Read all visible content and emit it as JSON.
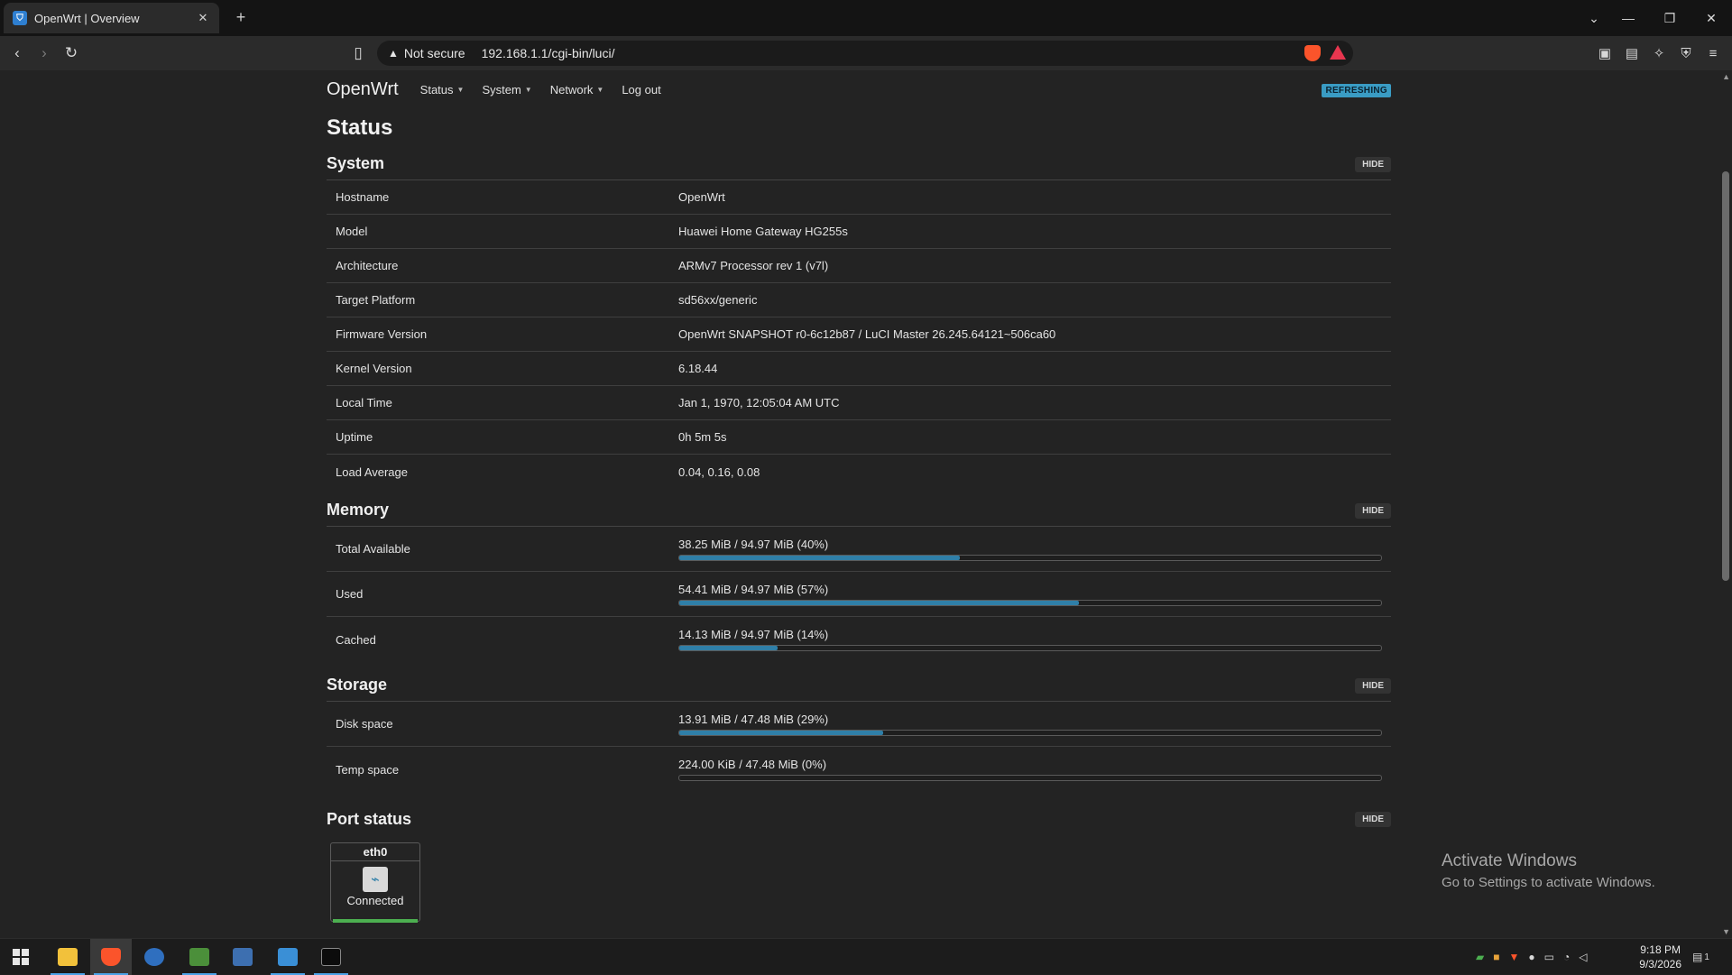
{
  "browser": {
    "tab_title": "OpenWrt | Overview",
    "new_tab": "+",
    "security_label": "Not secure",
    "url": "192.168.1.1/cgi-bin/luci/"
  },
  "header": {
    "brand": "OpenWrt",
    "menu": [
      "Status",
      "System",
      "Network",
      "Log out"
    ],
    "badge": "REFRESHING"
  },
  "page_title": "Status",
  "hide_label": "HIDE",
  "system": {
    "title": "System",
    "rows": [
      {
        "key": "Hostname",
        "value": "OpenWrt"
      },
      {
        "key": "Model",
        "value": "Huawei Home Gateway HG255s"
      },
      {
        "key": "Architecture",
        "value": "ARMv7 Processor rev 1 (v7l)"
      },
      {
        "key": "Target Platform",
        "value": "sd56xx/generic"
      },
      {
        "key": "Firmware Version",
        "value": "OpenWrt SNAPSHOT r0-6c12b87 / LuCI Master 26.245.64121~506ca60"
      },
      {
        "key": "Kernel Version",
        "value": "6.18.44"
      },
      {
        "key": "Local Time",
        "value": "Jan 1, 1970, 12:05:04 AM UTC"
      },
      {
        "key": "Uptime",
        "value": "0h 5m 5s"
      },
      {
        "key": "Load Average",
        "value": "0.04, 0.16, 0.08"
      }
    ]
  },
  "memory": {
    "title": "Memory",
    "rows": [
      {
        "key": "Total Available",
        "value": "38.25 MiB / 94.97 MiB (40%)",
        "percent": 40
      },
      {
        "key": "Used",
        "value": "54.41 MiB / 94.97 MiB (57%)",
        "percent": 57
      },
      {
        "key": "Cached",
        "value": "14.13 MiB / 94.97 MiB (14%)",
        "percent": 14
      }
    ]
  },
  "storage": {
    "title": "Storage",
    "rows": [
      {
        "key": "Disk space",
        "value": "13.91 MiB / 47.48 MiB (29%)",
        "percent": 29
      },
      {
        "key": "Temp space",
        "value": "224.00 KiB / 47.48 MiB (0%)",
        "percent": 0
      }
    ]
  },
  "port_status": {
    "title": "Port status",
    "ports": [
      {
        "name": "eth0",
        "status": "Connected"
      }
    ]
  },
  "watermark": {
    "line1": "Activate Windows",
    "line2": "Go to Settings to activate Windows."
  },
  "taskbar": {
    "time": "9:18 PM",
    "date": "9/3/2026",
    "notification_count": "1"
  }
}
